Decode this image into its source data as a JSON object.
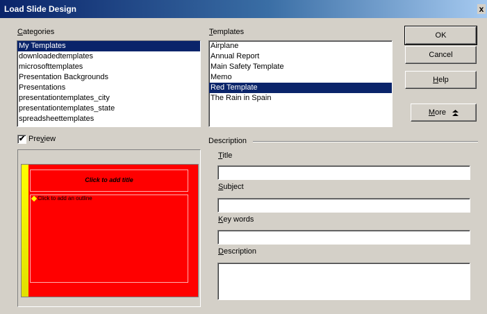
{
  "window": {
    "title": "Load Slide Design",
    "close_glyph": "x"
  },
  "categories": {
    "label": "Categories",
    "items": [
      "My Templates",
      "downloadedtemplates",
      "microsofttemplates",
      "Presentation Backgrounds",
      "Presentations",
      "presentationtemplates_city",
      "presentationtemplates_state",
      "spreadsheettemplates"
    ],
    "selected_index": 0
  },
  "templates": {
    "label": "Templates",
    "items": [
      "Airplane",
      "Annual Report",
      "Main Safety Template",
      "Memo",
      "Red Template",
      "The Rain in Spain"
    ],
    "selected_index": 4
  },
  "buttons": {
    "ok": "OK",
    "cancel": "Cancel",
    "help": "Help",
    "more": "More",
    "more_icon": "double-chevron-up-icon"
  },
  "preview": {
    "label": "Preview",
    "checked": true,
    "check_glyph": "✔"
  },
  "slide": {
    "title_placeholder": "Click to add title",
    "outline_placeholder": "Click to add an outline",
    "background_color": "#ff0000",
    "stripe_color": "#ffff00"
  },
  "description": {
    "group_label": "Description",
    "title_label": "Title",
    "title_value": "",
    "subject_label": "Subject",
    "subject_value": "",
    "keywords_label": "Key words",
    "keywords_value": "",
    "description_label": "Description",
    "description_value": ""
  },
  "colors": {
    "selection": "#0a246a",
    "dialog_bg": "#d4d0c8"
  }
}
